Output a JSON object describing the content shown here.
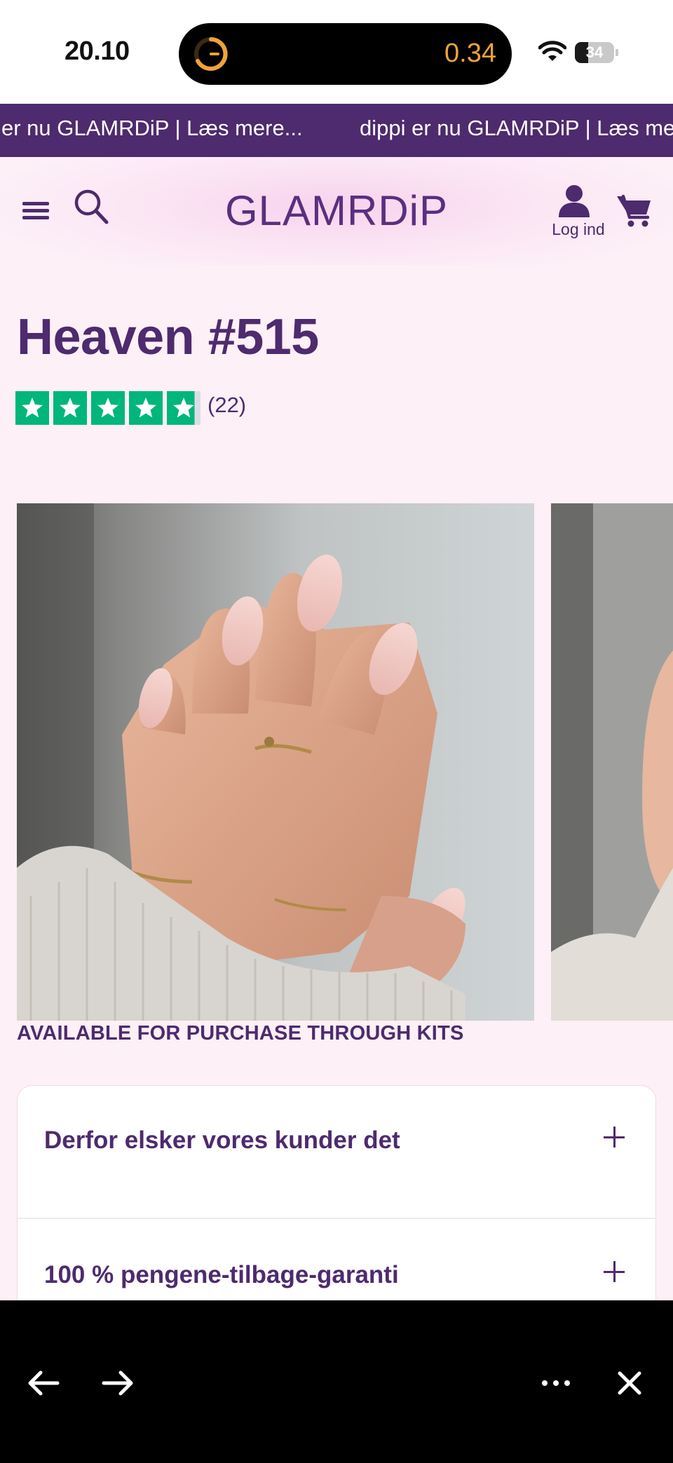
{
  "status_bar": {
    "time": "20.10",
    "island_value": "0.34",
    "battery_percent": "34",
    "battery_level": 0.34
  },
  "announcement": {
    "segments": [
      "er nu GLAMRDiP | Læs mere...",
      "dippi er nu GLAMRDiP | Læs mere..."
    ]
  },
  "header": {
    "logo": "GLAMRDiP",
    "account_label": "Log ind",
    "icons": {
      "menu": "hamburger-menu-icon",
      "search": "search-icon",
      "account": "user-icon",
      "cart": "cart-icon"
    }
  },
  "product": {
    "title": "Heaven #515",
    "rating": 4.8,
    "review_count": "(22)",
    "availability": "AVAILABLE FOR PURCHASE THROUGH KITS"
  },
  "accordions": [
    {
      "title": "Derfor elsker vores kunder det"
    },
    {
      "title": "100 % pengene-tilbage-garanti"
    }
  ],
  "colors": {
    "brand_purple": "#4e2a6e",
    "page_background": "#fdf0f6",
    "trustpilot_green": "#00b67a",
    "timer_orange": "#f0a23a"
  },
  "browser_toolbar": {
    "icons": [
      "back-arrow-icon",
      "forward-arrow-icon",
      "more-icon",
      "close-icon"
    ]
  }
}
